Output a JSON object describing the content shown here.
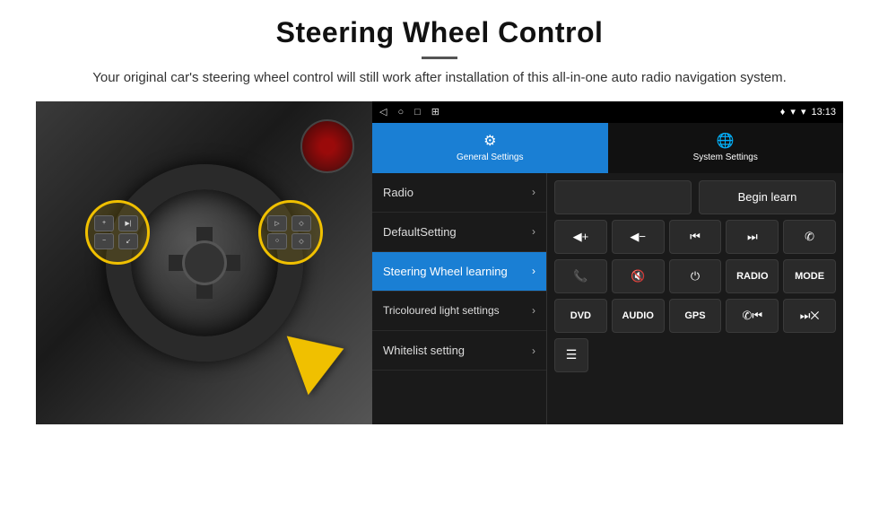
{
  "header": {
    "title": "Steering Wheel Control",
    "subtitle": "Your original car's steering wheel control will still work after installation of this all-in-one auto radio navigation system."
  },
  "status_bar": {
    "nav_icons": [
      "◁",
      "○",
      "□",
      "⊞"
    ],
    "signal_icon": "▼",
    "wifi_icon": "▾",
    "time": "13:13"
  },
  "tabs": [
    {
      "id": "general",
      "label": "General Settings",
      "icon": "⚙",
      "active": true
    },
    {
      "id": "system",
      "label": "System Settings",
      "icon": "🌐",
      "active": false
    }
  ],
  "menu_items": [
    {
      "id": "radio",
      "label": "Radio",
      "active": false
    },
    {
      "id": "default",
      "label": "DefaultSetting",
      "active": false
    },
    {
      "id": "steering",
      "label": "Steering Wheel learning",
      "active": true
    },
    {
      "id": "tricoloured",
      "label": "Tricoloured light settings",
      "active": false
    },
    {
      "id": "whitelist",
      "label": "Whitelist setting",
      "active": false
    }
  ],
  "control_panel": {
    "begin_learn_label": "Begin learn",
    "row1": [
      {
        "id": "vol_up",
        "icon": "◀+",
        "label": "vol-up"
      },
      {
        "id": "vol_down",
        "icon": "◀−",
        "label": "vol-down"
      },
      {
        "id": "prev_track",
        "icon": "⏮",
        "label": "prev-track"
      },
      {
        "id": "next_track",
        "icon": "⏭",
        "label": "next-track"
      },
      {
        "id": "phone",
        "icon": "✆",
        "label": "phone"
      }
    ],
    "row2": [
      {
        "id": "call_accept",
        "icon": "↙",
        "label": "call-accept"
      },
      {
        "id": "mute",
        "icon": "🔇",
        "label": "mute"
      },
      {
        "id": "power",
        "icon": "⏻",
        "label": "power"
      },
      {
        "id": "radio_btn",
        "label": "RADIO",
        "text": true
      },
      {
        "id": "mode_btn",
        "label": "MODE",
        "text": true
      }
    ],
    "row3": [
      {
        "id": "dvd",
        "label": "DVD",
        "text": true
      },
      {
        "id": "audio",
        "label": "AUDIO",
        "text": true
      },
      {
        "id": "gps",
        "label": "GPS",
        "text": true
      },
      {
        "id": "phone2",
        "icon": "✆⏮",
        "label": "phone-prev"
      },
      {
        "id": "skip_next",
        "icon": "⏭✕",
        "label": "skip-next"
      }
    ],
    "row4": [
      {
        "id": "menu_icon",
        "icon": "☰",
        "label": "menu-icon"
      }
    ]
  }
}
